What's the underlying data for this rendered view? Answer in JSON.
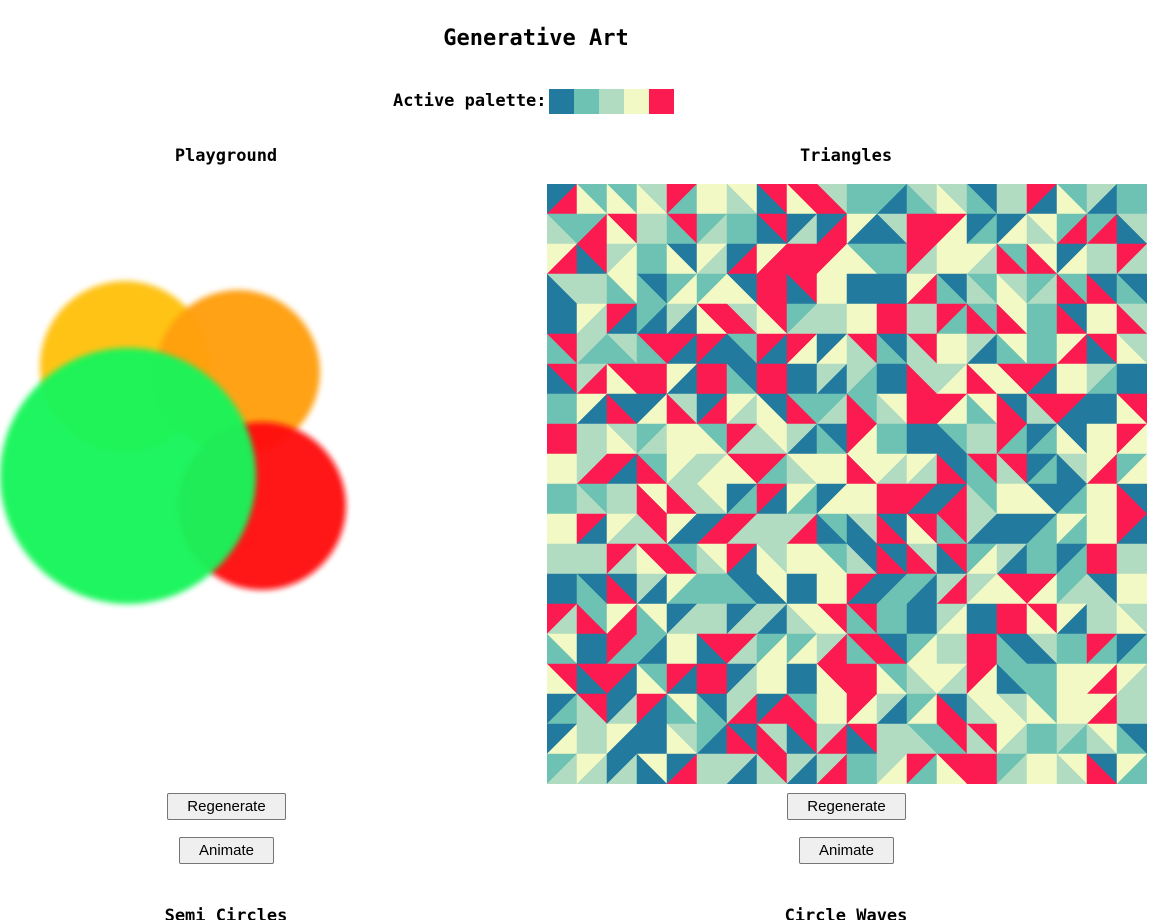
{
  "page": {
    "title": "Generative Art",
    "palette_label": "Active palette:",
    "palette": [
      "#227a9f",
      "#6ec2b4",
      "#b1dcc2",
      "#f2f9c4",
      "#fc1b51"
    ]
  },
  "panels": [
    {
      "title": "Playground",
      "regenerate_label": "Regenerate",
      "animate_label": "Animate"
    },
    {
      "title": "Triangles",
      "regenerate_label": "Regenerate",
      "animate_label": "Animate"
    }
  ],
  "playground": {
    "circle_colors": [
      "#ffc107",
      "#ff9f0a",
      "#ff0d0d",
      "#14f55a"
    ]
  },
  "next_panels": [
    {
      "title": "Semi Circles"
    },
    {
      "title": "Circle Waves"
    }
  ]
}
